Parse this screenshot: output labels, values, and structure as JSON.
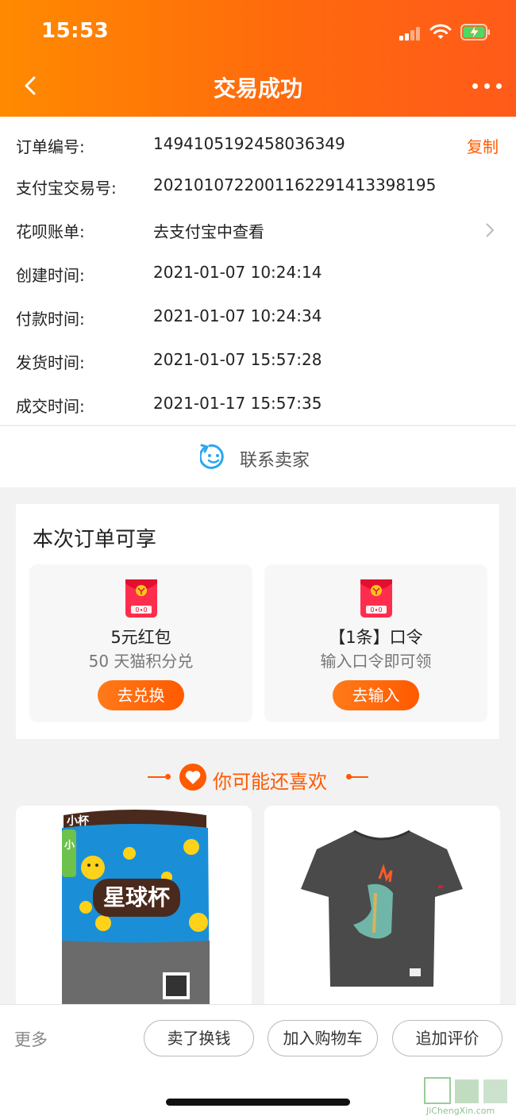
{
  "status_bar": {
    "time": "15:53"
  },
  "nav": {
    "title": "交易成功"
  },
  "order": {
    "rows": [
      {
        "label": "订单编号:",
        "value": "1494105192458036349"
      },
      {
        "label": "支付宝交易号:",
        "value": "2021010722001162291413398195"
      },
      {
        "label": "花呗账单:",
        "value": "去支付宝中查看"
      },
      {
        "label": "创建时间:",
        "value": "2021-01-07 10:24:14"
      },
      {
        "label": "付款时间:",
        "value": "2021-01-07 10:24:34"
      },
      {
        "label": "发货时间:",
        "value": "2021-01-07 15:57:28"
      },
      {
        "label": "成交时间:",
        "value": "2021-01-17 15:57:35"
      }
    ],
    "copy_label": "复制"
  },
  "contact": {
    "label": "联系卖家"
  },
  "benefits": {
    "title": "本次订单可享",
    "cards": [
      {
        "name": "5元红包",
        "desc": "50 天猫积分兑",
        "button": "去兑换"
      },
      {
        "name": "【1条】口令",
        "desc": "输入口令即可领",
        "button": "去输入"
      }
    ]
  },
  "recommend": {
    "title": "你可能还喜欢"
  },
  "products": [
    {
      "image_text": "星球杯",
      "badge": "小"
    },
    {
      "image_text": ""
    }
  ],
  "bottom_bar": {
    "more": "更多",
    "buttons": [
      "卖了换钱",
      "加入购物车",
      "追加评价"
    ]
  },
  "watermark": {
    "text": "JiChengXin.com"
  },
  "colors": {
    "accent": "#ff5a00",
    "header_start": "#ff8a00",
    "header_end": "#ff5a1a"
  }
}
